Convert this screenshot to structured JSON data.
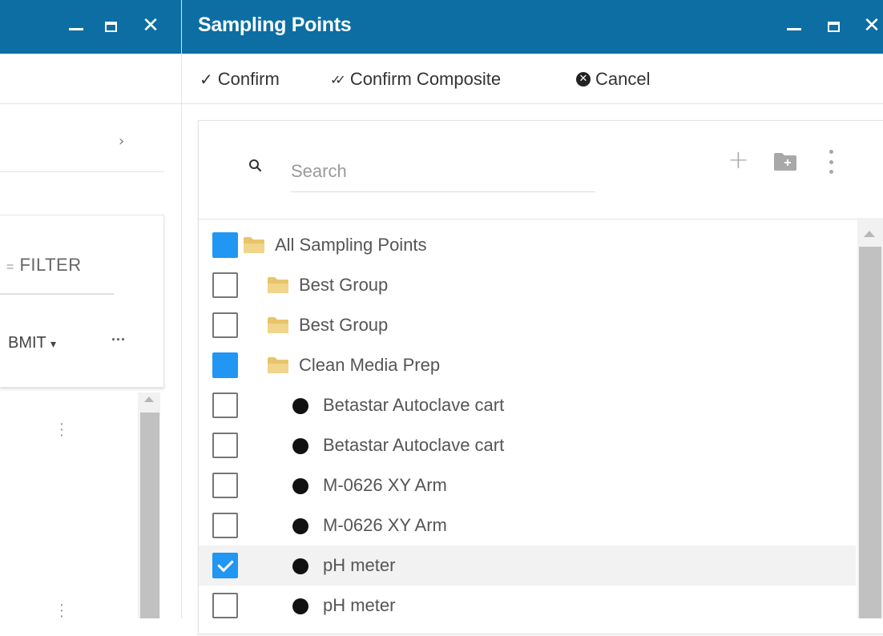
{
  "left_window": {
    "filter_label": "FILTER",
    "filter_prefix": "=",
    "submit_label": "BMIT",
    "submit_caret": "▾",
    "more_label": "···",
    "chevron": "›",
    "kebab": "⋮"
  },
  "main_window": {
    "title": "Sampling Points",
    "window_controls": {
      "minimize": "",
      "maximize": "",
      "close": "✕"
    },
    "toolbar": {
      "confirm_icon": "✓",
      "confirm_label": "Confirm",
      "confirm_composite_icon": "✓✓",
      "confirm_composite_label": "Confirm Composite",
      "cancel_icon": "✕",
      "cancel_label": "Cancel"
    },
    "search": {
      "placeholder": "Search",
      "value": ""
    },
    "actions": {
      "add_icon": "+"
    },
    "tree": [
      {
        "label": "All Sampling Points",
        "type": "folder",
        "state": "indeterminate",
        "level": 0
      },
      {
        "label": "Best Group",
        "type": "folder",
        "state": "unchecked",
        "level": 1
      },
      {
        "label": "Best Group",
        "type": "folder",
        "state": "unchecked",
        "level": 1
      },
      {
        "label": "Clean Media Prep",
        "type": "folder",
        "state": "indeterminate",
        "level": 1
      },
      {
        "label": "Betastar Autoclave cart",
        "type": "point",
        "state": "unchecked",
        "level": 2
      },
      {
        "label": "Betastar Autoclave cart",
        "type": "point",
        "state": "unchecked",
        "level": 2
      },
      {
        "label": "M-0626 XY Arm",
        "type": "point",
        "state": "unchecked",
        "level": 2
      },
      {
        "label": "M-0626 XY Arm",
        "type": "point",
        "state": "unchecked",
        "level": 2
      },
      {
        "label": "pH meter",
        "type": "point",
        "state": "checked",
        "level": 2
      },
      {
        "label": "pH meter",
        "type": "point",
        "state": "unchecked",
        "level": 2
      }
    ],
    "colors": {
      "titlebar": "#0c6ea3",
      "checkbox_accent": "#2196f3",
      "folder": "#f0d58a"
    }
  }
}
